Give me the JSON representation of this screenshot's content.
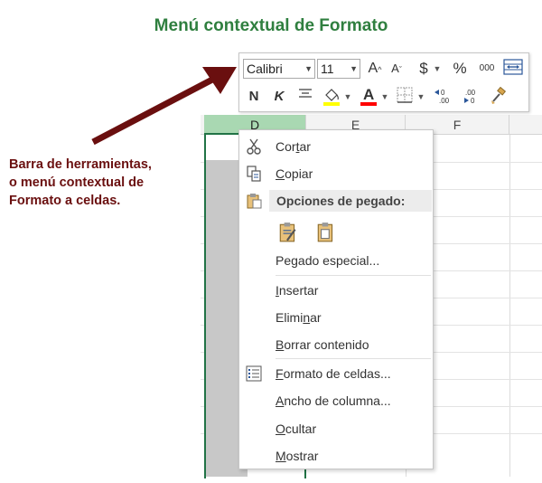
{
  "title": "Menú contextual de Formato",
  "annotation": {
    "lines": [
      "Barra de herramientas,",
      "o menú contextual de",
      "Formato a celdas."
    ],
    "color": "#6a0f0f"
  },
  "sheet": {
    "columns": [
      "D",
      "E",
      "F"
    ],
    "selected_column": "D",
    "accent": "#217346"
  },
  "mini_toolbar": {
    "font_name": "Calibri",
    "font_size": "11",
    "grow_font": "A",
    "shrink_font": "A",
    "currency": "$",
    "percent": "%",
    "thousands": "000",
    "bold": "N",
    "italic": "K",
    "highlight_color": "#ffff00",
    "font_color": "#ff0000"
  },
  "context_menu": {
    "cut": {
      "before": "Cor",
      "ul": "t",
      "after": "ar"
    },
    "copy": {
      "before": "",
      "ul": "C",
      "after": "opiar"
    },
    "paste_header": "Opciones de pegado:",
    "paste_special": {
      "before": "Pe",
      "ul": "g",
      "after": "ado especial..."
    },
    "insert": {
      "before": "",
      "ul": "I",
      "after": "nsertar"
    },
    "delete": {
      "before": "Elimi",
      "ul": "n",
      "after": "ar"
    },
    "clear": {
      "before": "",
      "ul": "B",
      "after": "orrar contenido"
    },
    "format_cells": {
      "before": "",
      "ul": "F",
      "after": "ormato de celdas..."
    },
    "column_width": {
      "before": "",
      "ul": "A",
      "after": "ncho de columna..."
    },
    "hide": {
      "before": "",
      "ul": "O",
      "after": "cultar"
    },
    "show": {
      "before": "",
      "ul": "M",
      "after": "ostrar"
    }
  }
}
